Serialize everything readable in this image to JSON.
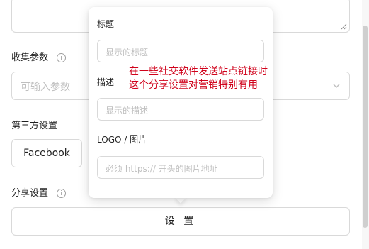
{
  "form": {
    "params_label": "收集参数",
    "params_placeholder": "可输入参数",
    "third_party_label": "第三方设置",
    "facebook_label": "Facebook",
    "share_label": "分享设置",
    "settings_button": "设 置"
  },
  "popover": {
    "title_label": "标题",
    "title_placeholder": "显示的标题",
    "desc_label": "描述",
    "desc_placeholder": "显示的描述",
    "image_label": "LOGO / 图片",
    "image_placeholder": "必须 https:// 开头的图片地址"
  },
  "annotation": {
    "line1": "在一些社交软件发送站点链接时",
    "line2": "这个分享设置对营销特别有用"
  },
  "icons": {
    "info": "info-circle-icon",
    "chevron": "chevron-down-icon",
    "resize": "resize-grip-icon"
  },
  "colors": {
    "annotation": "#d0021b",
    "border": "#d9d9d9",
    "placeholder": "#bfbfbf"
  }
}
